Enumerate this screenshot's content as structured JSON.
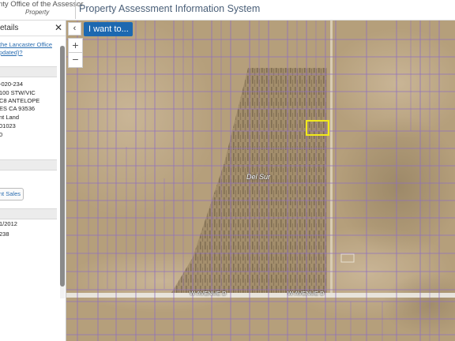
{
  "header": {
    "agency": "nty Office of the Assessor",
    "sub": "Property",
    "system_title": "Property Assessment Information System"
  },
  "sidebar": {
    "title": "etails",
    "close_icon": "close-icon",
    "link_line1": "the Lancaster Office",
    "link_line2": "pdated)?",
    "ain": "-020-234",
    "addr1": "100 STW/VIC",
    "addr2": "C8 ANTELOPE",
    "addr3": "ES CA 93536",
    "use": "nt Land",
    "code": "01023",
    "val": "0",
    "recent_sales": "nt Sales",
    "date": "1/2012",
    "num": "238"
  },
  "map": {
    "collapse_icon": "chevron-left-icon",
    "i_want_to": "I want to...",
    "zoom_in": "+",
    "zoom_out": "−",
    "place_label": "Del Sur",
    "road_label_1": "W AVENUE D",
    "road_label_2": "W AVENUE D"
  },
  "colors": {
    "parcel_lines": "#8f6fc0",
    "selected_parcel": "#f2ea1a",
    "button_blue": "#1c68b0",
    "link_blue": "#2a6db0"
  }
}
